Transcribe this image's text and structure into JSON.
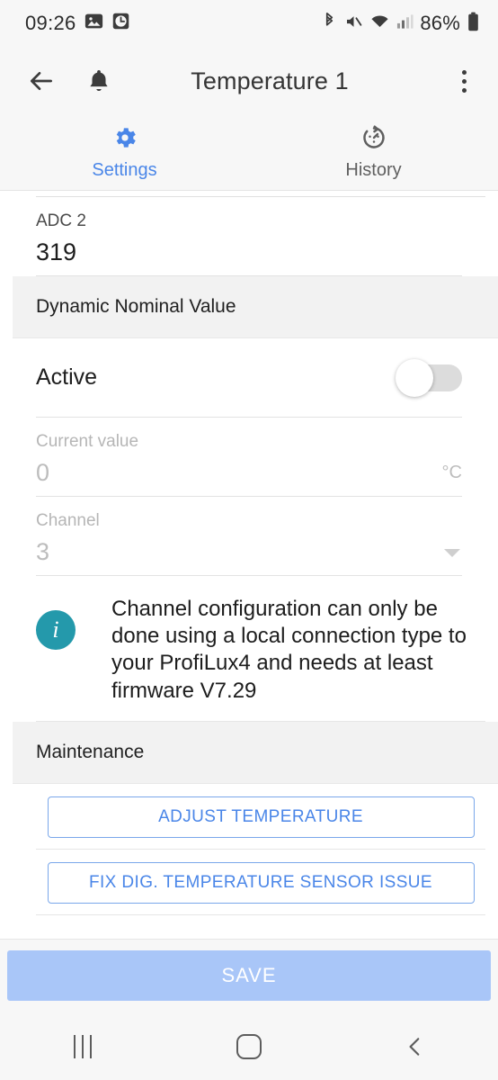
{
  "statusbar": {
    "time": "09:26",
    "battery_percent": "86%",
    "icons_left": [
      "photo-icon",
      "alarm-clock-icon"
    ],
    "icons_right": [
      "bluetooth-icon",
      "volume-mute-icon",
      "wifi-icon",
      "cellular-signal-icon",
      "battery-icon"
    ]
  },
  "appbar": {
    "back_icon": "back-arrow-icon",
    "bell_icon": "notification-bell-icon",
    "title": "Temperature 1",
    "overflow_icon": "overflow-menu-icon"
  },
  "tabs": [
    {
      "label": "Settings",
      "icon": "gear-icon",
      "active": true
    },
    {
      "label": "History",
      "icon": "history-timer-icon",
      "active": false
    }
  ],
  "content": {
    "adc_field": {
      "label": "ADC 2",
      "value": "319"
    },
    "dynamic_section": {
      "title": "Dynamic Nominal Value"
    },
    "active_row": {
      "label": "Active",
      "toggle_state": "off"
    },
    "current_value_field": {
      "label": "Current value",
      "value": "0",
      "suffix": "°C",
      "disabled": true
    },
    "channel_field": {
      "label": "Channel",
      "value": "3",
      "disabled": true,
      "dropdown_icon": "chevron-down-icon"
    },
    "info_note": {
      "icon": "info-icon",
      "text": "Channel configuration can only be done using a local connection type to your ProfiLux4 and needs at least firmware V7.29"
    },
    "maintenance_section": {
      "title": "Maintenance"
    },
    "maintenance_buttons": [
      {
        "label": "ADJUST TEMPERATURE"
      },
      {
        "label": "FIX DIG. TEMPERATURE SENSOR ISSUE"
      }
    ]
  },
  "save_bar": {
    "label": "SAVE"
  },
  "navbar": {
    "recents_icon": "recents-icon",
    "home_icon": "home-icon",
    "back_icon": "nav-back-icon"
  },
  "colors": {
    "accent_blue": "#4a86e8",
    "info_teal": "#2499ab",
    "save_button": "#a9c6f8",
    "section_bg": "#f2f2f2"
  }
}
